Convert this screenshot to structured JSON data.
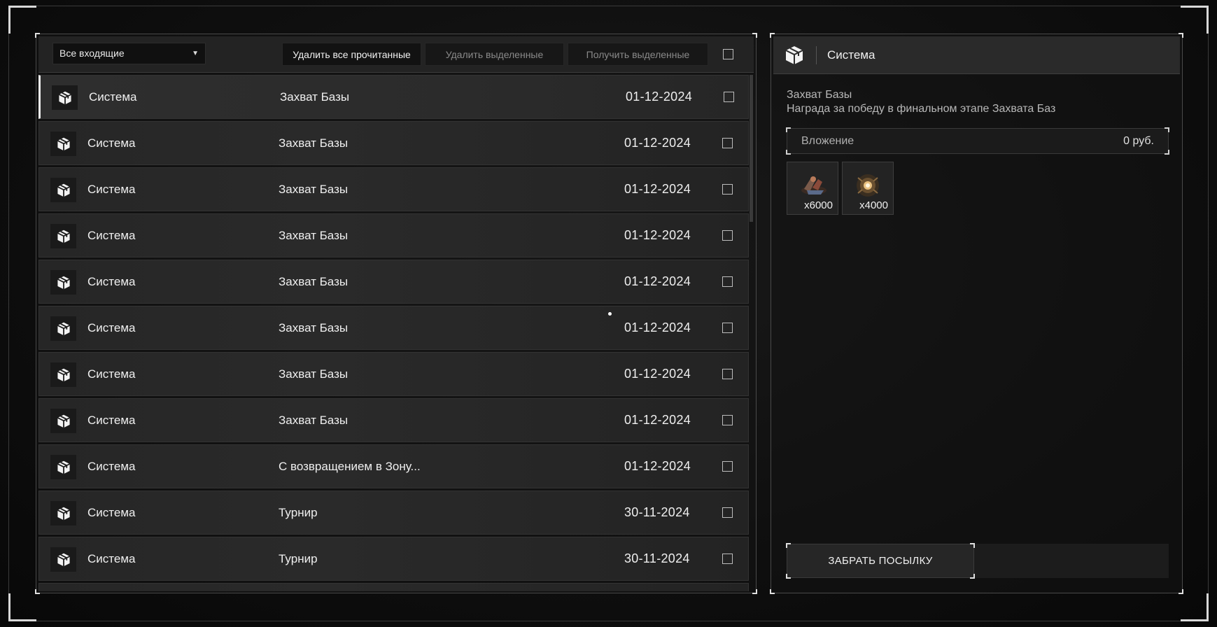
{
  "toolbar": {
    "filter_value": "Все входящие",
    "delete_read_label": "Удалить все прочитанные",
    "delete_selected_label": "Удалить выделенные",
    "get_selected_label": "Получить выделенные"
  },
  "messages": [
    {
      "sender": "Система",
      "subject": "Захват Базы",
      "date": "01-12-2024"
    },
    {
      "sender": "Система",
      "subject": "Захват Базы",
      "date": "01-12-2024"
    },
    {
      "sender": "Система",
      "subject": "Захват Базы",
      "date": "01-12-2024"
    },
    {
      "sender": "Система",
      "subject": "Захват Базы",
      "date": "01-12-2024"
    },
    {
      "sender": "Система",
      "subject": "Захват Базы",
      "date": "01-12-2024"
    },
    {
      "sender": "Система",
      "subject": "Захват Базы",
      "date": "01-12-2024"
    },
    {
      "sender": "Система",
      "subject": "Захват Базы",
      "date": "01-12-2024"
    },
    {
      "sender": "Система",
      "subject": "Захват Базы",
      "date": "01-12-2024"
    },
    {
      "sender": "Система",
      "subject": "С возвращением в Зону...",
      "date": "01-12-2024"
    },
    {
      "sender": "Система",
      "subject": "Турнир",
      "date": "30-11-2024"
    },
    {
      "sender": "Система",
      "subject": "Турнир",
      "date": "30-11-2024"
    }
  ],
  "detail": {
    "sender": "Система",
    "subject": "Захват Базы",
    "description": "Награда за победу в финальном этапе Захвата Баз",
    "attachment_label": "Вложение",
    "attachment_value": "0  руб.",
    "items": [
      {
        "qty": "x6000",
        "icon": "ammo-icon"
      },
      {
        "qty": "x4000",
        "icon": "artifact-icon"
      }
    ],
    "claim_label": "ЗАБРАТЬ ПОСЫЛКУ"
  },
  "colors": {
    "background": "#0f0f0f",
    "row": "#282828",
    "accent_border": "#ededed"
  }
}
